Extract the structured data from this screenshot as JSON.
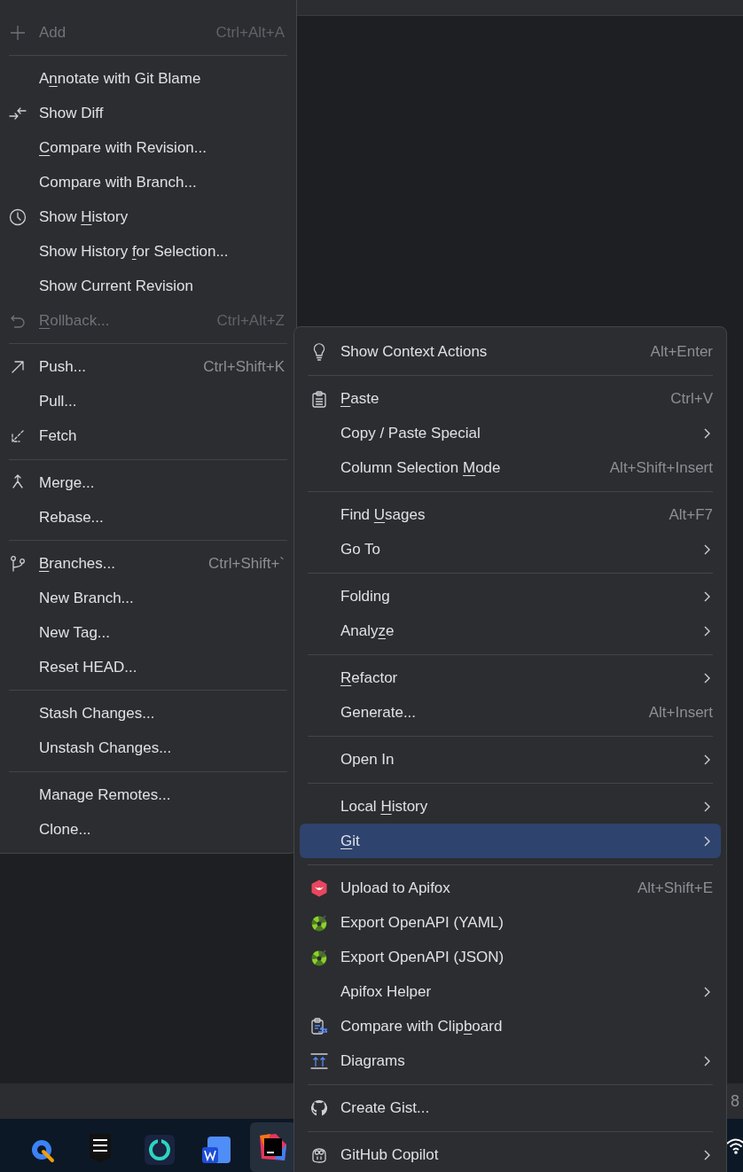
{
  "left_menu": {
    "items": [
      {
        "kind": "item",
        "label": "Add",
        "shortcut": "Ctrl+Alt+A",
        "disabled": true
      },
      {
        "kind": "separator"
      },
      {
        "kind": "item",
        "label": [
          {
            "text": "A",
            "underlined": false
          },
          {
            "text": "n",
            "underlined": true
          },
          {
            "text": "notate with Git Blame",
            "underlined": false
          }
        ],
        "disabled": false
      },
      {
        "kind": "item",
        "label": "Show Diff",
        "disabled": false
      },
      {
        "kind": "item",
        "label": [
          {
            "text": "C",
            "underlined": true
          },
          {
            "text": "ompare with Revision...",
            "underlined": false
          }
        ],
        "disabled": false
      },
      {
        "kind": "item",
        "label": "Compare with Branch...",
        "disabled": false
      },
      {
        "kind": "item",
        "label": [
          {
            "text": "Show ",
            "underlined": false
          },
          {
            "text": "H",
            "underlined": true
          },
          {
            "text": "istory",
            "underlined": false
          }
        ],
        "disabled": false
      },
      {
        "kind": "item",
        "label": [
          {
            "text": "Show History ",
            "underlined": false
          },
          {
            "text": "f",
            "underlined": true
          },
          {
            "text": "or Selection...",
            "underlined": false
          }
        ],
        "disabled": false
      },
      {
        "kind": "item",
        "label": "Show Current Revision",
        "disabled": false
      },
      {
        "kind": "item",
        "label": [
          {
            "text": "R",
            "underlined": true
          },
          {
            "text": "ollback...",
            "underlined": false
          }
        ],
        "shortcut": "Ctrl+Alt+Z",
        "disabled": true
      },
      {
        "kind": "separator"
      },
      {
        "kind": "item",
        "label": "Push...",
        "shortcut": "Ctrl+Shift+K",
        "disabled": false
      },
      {
        "kind": "item",
        "label": "Pull...",
        "disabled": false
      },
      {
        "kind": "item",
        "label": "Fetch",
        "disabled": false
      },
      {
        "kind": "separator"
      },
      {
        "kind": "item",
        "label": "Merge...",
        "disabled": false
      },
      {
        "kind": "item",
        "label": "Rebase...",
        "disabled": false
      },
      {
        "kind": "separator"
      },
      {
        "kind": "item",
        "label": [
          {
            "text": "B",
            "underlined": true
          },
          {
            "text": "ranches...",
            "underlined": false
          }
        ],
        "shortcut": "Ctrl+Shift+`",
        "disabled": false
      },
      {
        "kind": "item",
        "label": "New Branch...",
        "disabled": false
      },
      {
        "kind": "item",
        "label": "New Tag...",
        "disabled": false
      },
      {
        "kind": "item",
        "label": "Reset HEAD...",
        "disabled": false
      },
      {
        "kind": "separator"
      },
      {
        "kind": "item",
        "label": "Stash Changes...",
        "disabled": false
      },
      {
        "kind": "item",
        "label": "Unstash Changes...",
        "disabled": false
      },
      {
        "kind": "separator"
      },
      {
        "kind": "item",
        "label": "Manage Remotes...",
        "disabled": false
      },
      {
        "kind": "item",
        "label": "Clone...",
        "disabled": false
      }
    ]
  },
  "context_menu": {
    "items": [
      {
        "kind": "item",
        "label": "Show Context Actions",
        "shortcut": "Alt+Enter",
        "submenu": false,
        "selected": false
      },
      {
        "kind": "separator"
      },
      {
        "kind": "item",
        "label": [
          {
            "text": "P",
            "underlined": true
          },
          {
            "text": "aste",
            "underlined": false
          }
        ],
        "shortcut": "Ctrl+V",
        "submenu": false,
        "selected": false
      },
      {
        "kind": "item",
        "label": "Copy / Paste Special",
        "submenu": true,
        "selected": false
      },
      {
        "kind": "item",
        "label": [
          {
            "text": "Column Selection ",
            "underlined": false
          },
          {
            "text": "M",
            "underlined": true
          },
          {
            "text": "ode",
            "underlined": false
          }
        ],
        "shortcut": "Alt+Shift+Insert",
        "submenu": false,
        "selected": false
      },
      {
        "kind": "separator"
      },
      {
        "kind": "item",
        "label": [
          {
            "text": "Find ",
            "underlined": false
          },
          {
            "text": "U",
            "underlined": true
          },
          {
            "text": "sages",
            "underlined": false
          }
        ],
        "shortcut": "Alt+F7",
        "submenu": false,
        "selected": false
      },
      {
        "kind": "item",
        "label": "Go To",
        "submenu": true,
        "selected": false
      },
      {
        "kind": "separator"
      },
      {
        "kind": "item",
        "label": "Folding",
        "submenu": true,
        "selected": false
      },
      {
        "kind": "item",
        "label": [
          {
            "text": "Analy",
            "underlined": false
          },
          {
            "text": "z",
            "underlined": true
          },
          {
            "text": "e",
            "underlined": false
          }
        ],
        "submenu": true,
        "selected": false
      },
      {
        "kind": "separator"
      },
      {
        "kind": "item",
        "label": [
          {
            "text": "R",
            "underlined": true
          },
          {
            "text": "efactor",
            "underlined": false
          }
        ],
        "submenu": true,
        "selected": false
      },
      {
        "kind": "item",
        "label": "Generate...",
        "shortcut": "Alt+Insert",
        "submenu": false,
        "selected": false
      },
      {
        "kind": "separator"
      },
      {
        "kind": "item",
        "label": "Open In",
        "submenu": true,
        "selected": false
      },
      {
        "kind": "separator"
      },
      {
        "kind": "item",
        "label": [
          {
            "text": "Local ",
            "underlined": false
          },
          {
            "text": "H",
            "underlined": true
          },
          {
            "text": "istory",
            "underlined": false
          }
        ],
        "submenu": true,
        "selected": false
      },
      {
        "kind": "item",
        "label": [
          {
            "text": "G",
            "underlined": true
          },
          {
            "text": "it",
            "underlined": false
          }
        ],
        "submenu": true,
        "selected": true
      },
      {
        "kind": "separator"
      },
      {
        "kind": "item",
        "label": "Upload to Apifox",
        "shortcut": "Alt+Shift+E",
        "submenu": false,
        "selected": false
      },
      {
        "kind": "item",
        "label": "Export OpenAPI (YAML)",
        "submenu": false,
        "selected": false
      },
      {
        "kind": "item",
        "label": "Export OpenAPI (JSON)",
        "submenu": false,
        "selected": false
      },
      {
        "kind": "item",
        "label": "Apifox Helper",
        "submenu": true,
        "selected": false
      },
      {
        "kind": "item",
        "label": [
          {
            "text": "Compare with Clip",
            "underlined": false
          },
          {
            "text": "b",
            "underlined": true
          },
          {
            "text": "oard",
            "underlined": false
          }
        ],
        "submenu": false,
        "selected": false
      },
      {
        "kind": "item",
        "label": "Diagrams",
        "submenu": true,
        "selected": false
      },
      {
        "kind": "separator"
      },
      {
        "kind": "item",
        "label": "Create Gist...",
        "submenu": false,
        "selected": false
      },
      {
        "kind": "separator"
      },
      {
        "kind": "item",
        "label": "GitHub Copilot",
        "submenu": true,
        "selected": false
      }
    ]
  },
  "status_bar": {
    "text": "8"
  }
}
